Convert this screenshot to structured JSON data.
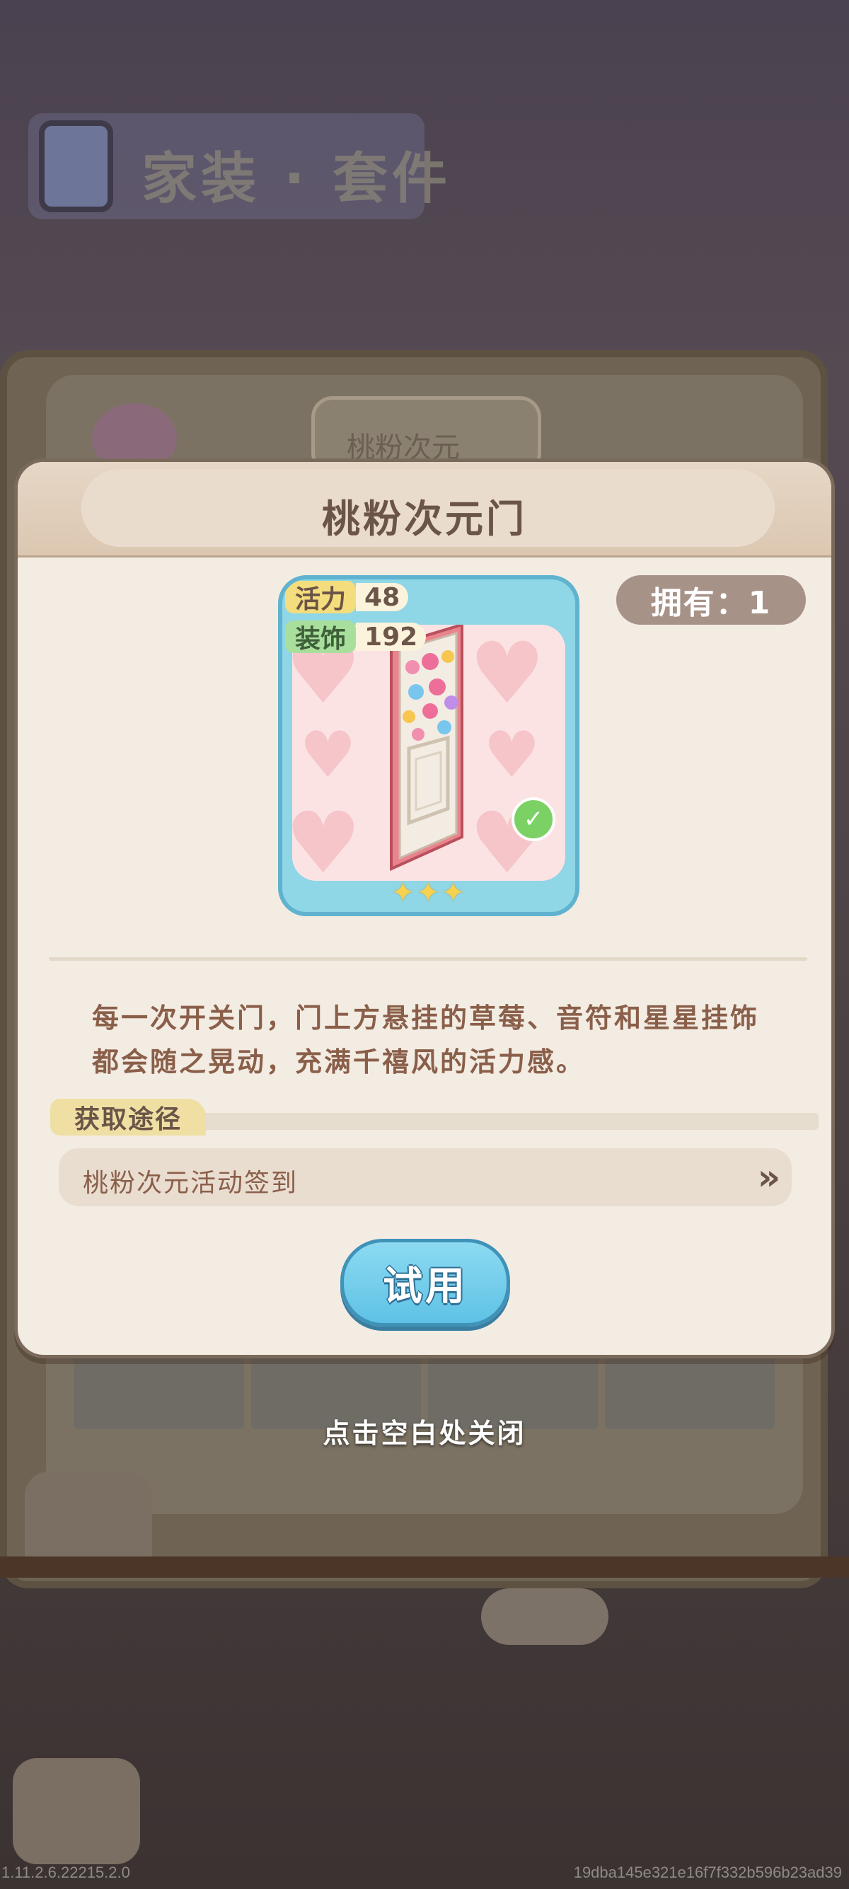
{
  "background": {
    "header_title": "家装 · 套件",
    "tab_label": "桃粉次元"
  },
  "modal": {
    "title": "桃粉次元门",
    "owned_label": "拥有：1",
    "stats": {
      "vitality_label": "活力",
      "vitality_value": "48",
      "decor_label": "装饰",
      "decor_value": "192"
    },
    "star_rating": 3,
    "stars_text": "✦✦✦",
    "owned_check_icon": "check-icon",
    "description": "每一次开关门，门上方悬挂的草莓、音符和星星挂饰都会随之晃动，充满千禧风的活力感。",
    "source_section_label": "获取途径",
    "source_entry": "桃粉次元活动签到",
    "source_arrow_icon": "double-chevron-right-icon",
    "try_button_label": "试用"
  },
  "close_hint": "点击空白处关闭",
  "footer": {
    "version": "1.11.2.6.22215.2.0",
    "build_hash": "19dba145e321e16f7f332b596b23ad39"
  },
  "colors": {
    "modal_bg": "#f3ece3",
    "card_blue": "#8fd6e6",
    "button_blue": "#5fc2e6",
    "title_brown": "#6b5448"
  }
}
